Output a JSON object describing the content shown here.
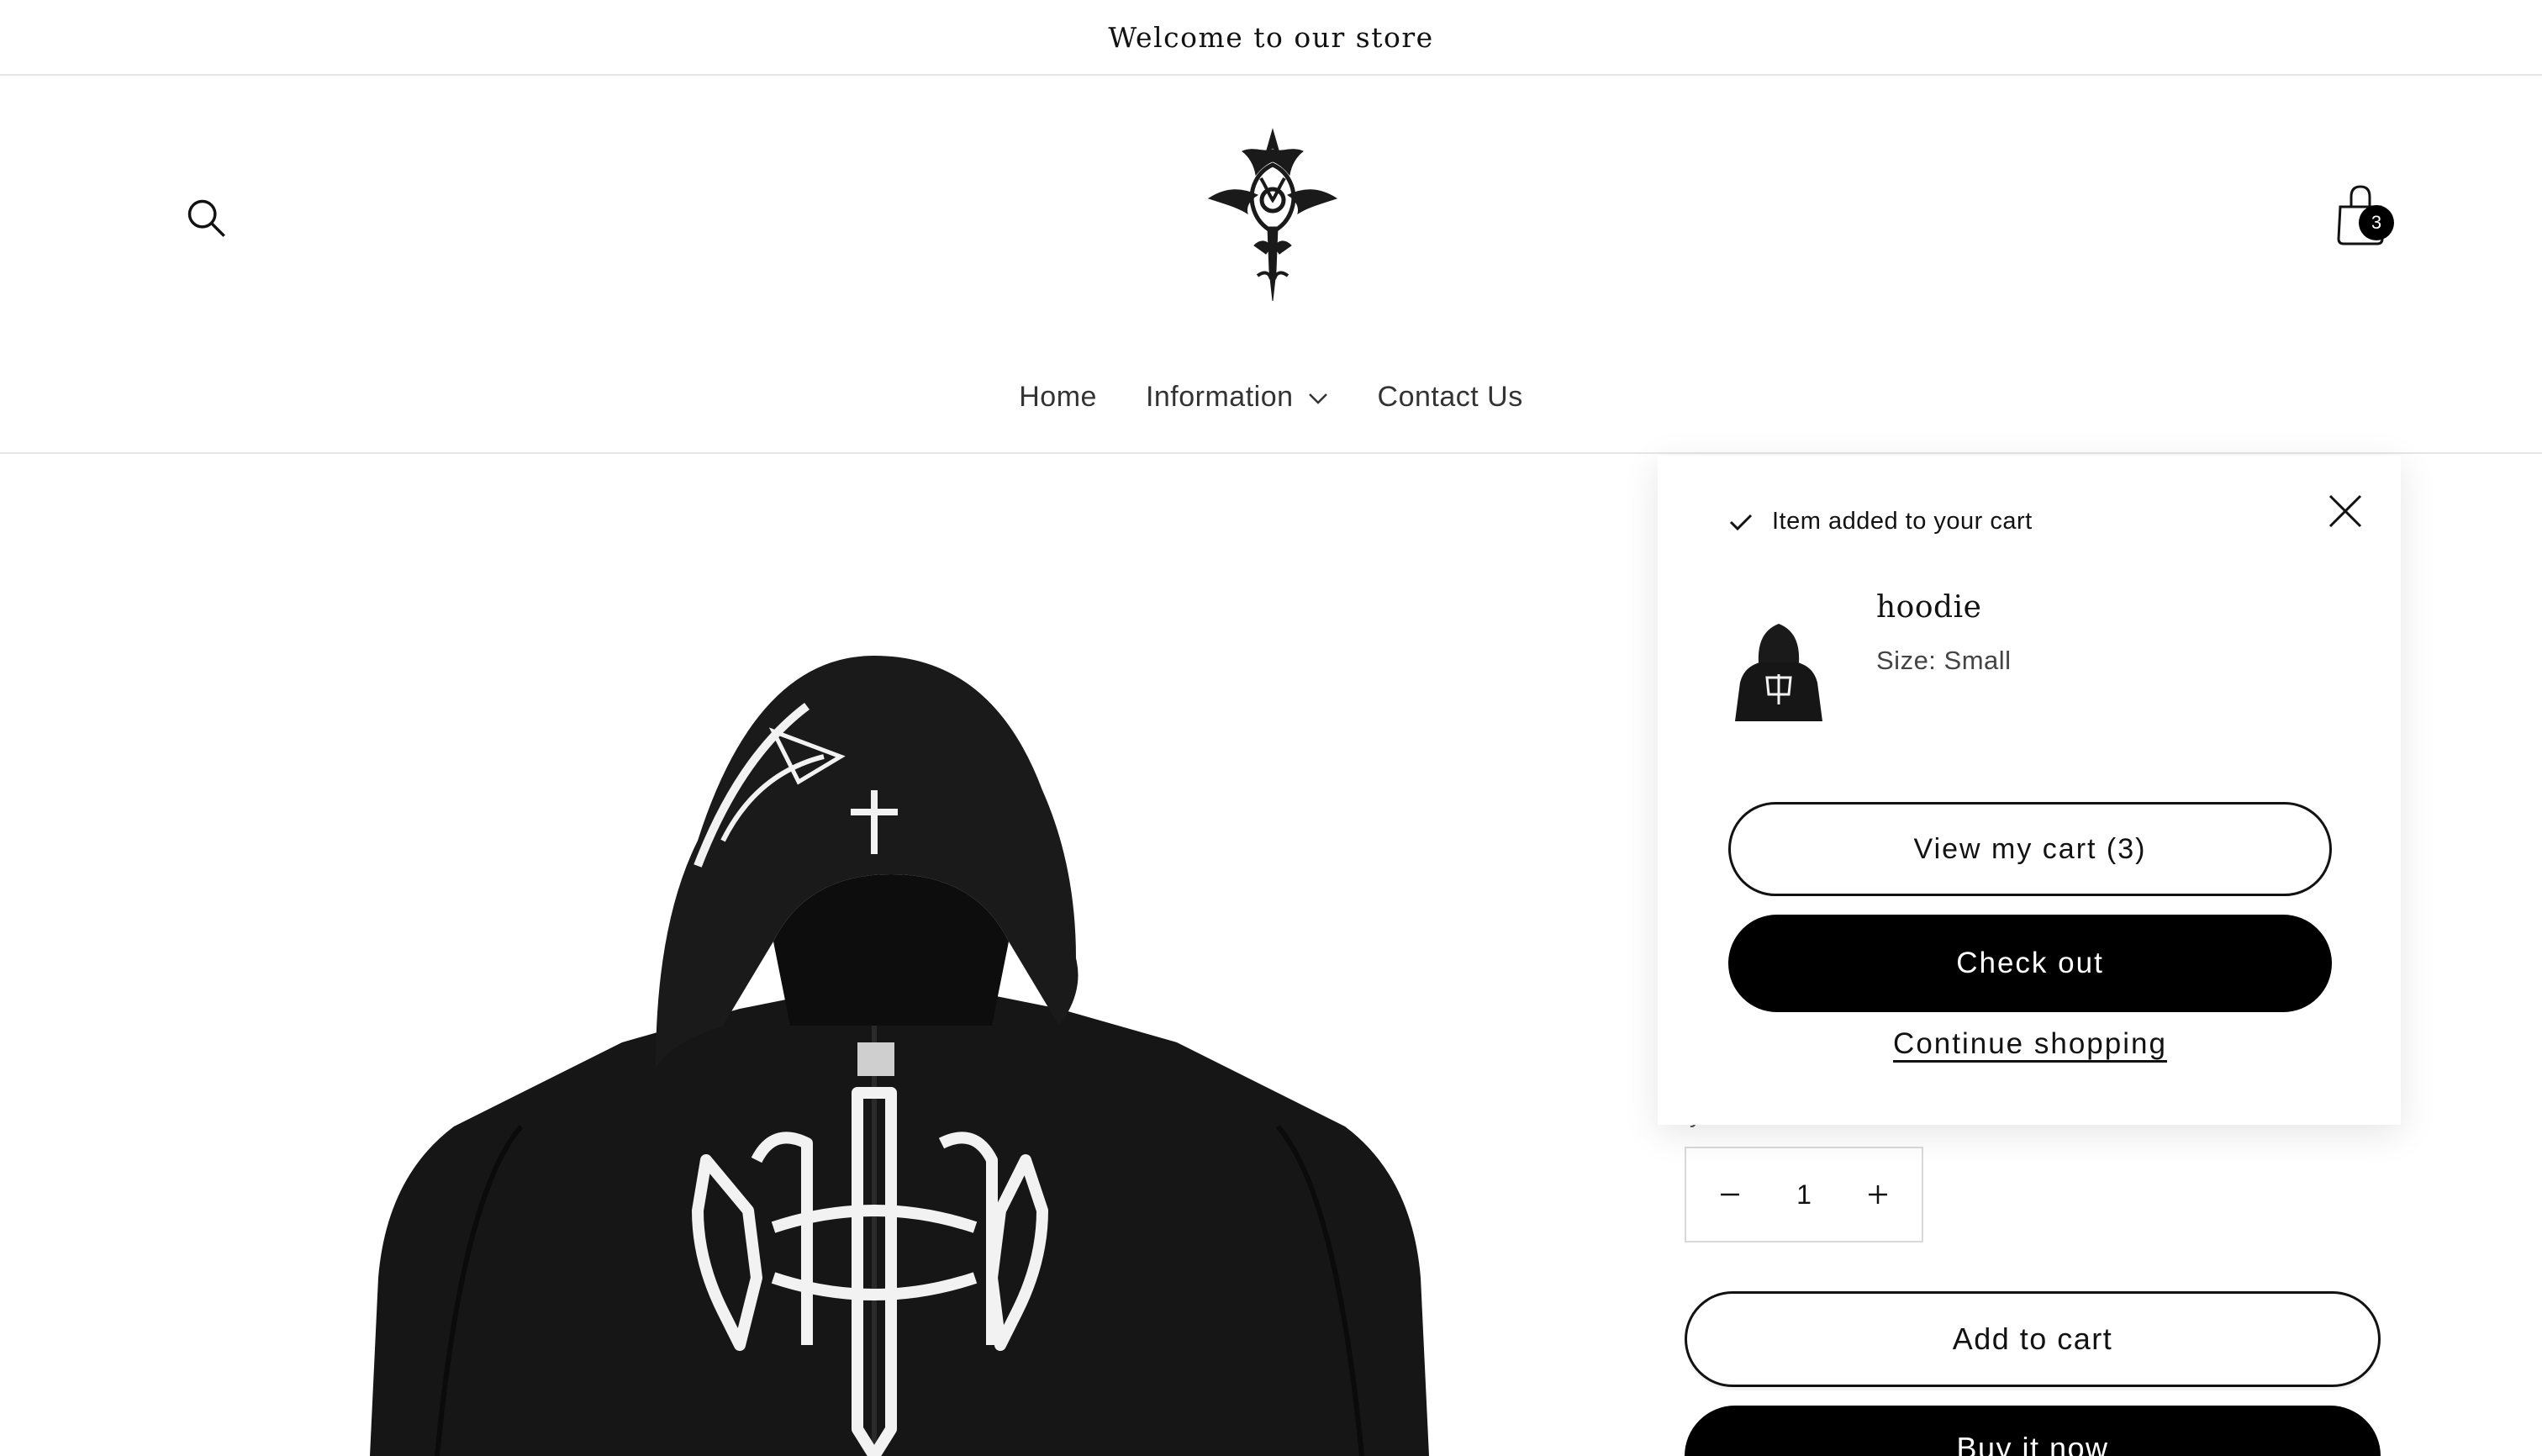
{
  "announcement": {
    "text": "Welcome to our store"
  },
  "header": {
    "logo_name": "gothic-cross-logo",
    "search_icon": "search-icon",
    "cart_icon": "shopping-bag-icon",
    "cart_count": "3"
  },
  "nav": {
    "items": [
      {
        "label": "Home"
      },
      {
        "label": "Information",
        "has_dropdown": true
      },
      {
        "label": "Contact Us"
      }
    ]
  },
  "product": {
    "image_name": "black-zip-hoodie-with-gothic-cross-print",
    "quantity": "1",
    "add_to_cart_label": "Add to cart",
    "buy_now_label": "Buy it now"
  },
  "cart_popup": {
    "heading": "Item added to your cart",
    "product_name": "hoodie",
    "variant_label": "Size:",
    "variant_value": "Small",
    "view_cart_label": "View my cart (3)",
    "checkout_label": "Check out",
    "continue_label": "Continue shopping"
  },
  "colors": {
    "primary": "#000000",
    "background": "#ffffff",
    "text": "#121212",
    "border": "#e6e6e6"
  }
}
